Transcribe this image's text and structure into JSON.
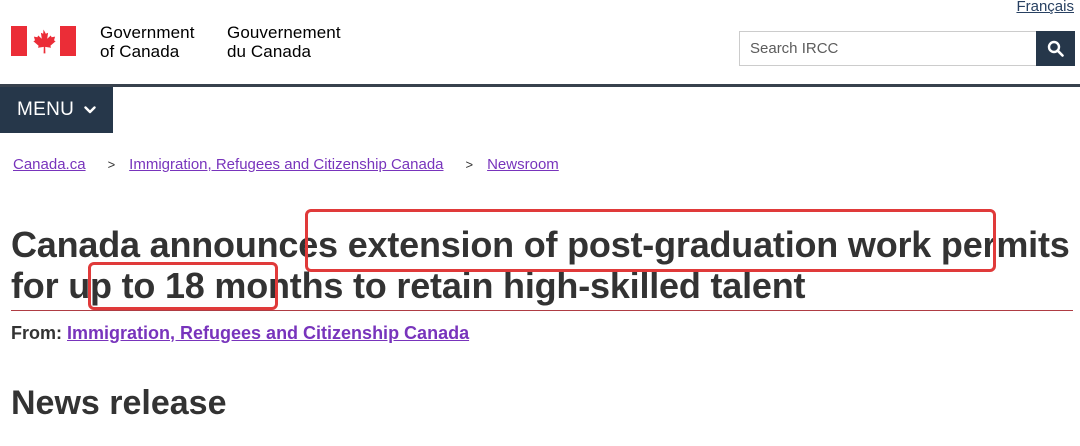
{
  "header": {
    "language_link": "Français",
    "wordmark_en_line1": "Government",
    "wordmark_en_line2": "of Canada",
    "wordmark_fr_line1": "Gouvernement",
    "wordmark_fr_line2": "du Canada",
    "search_placeholder": "Search IRCC",
    "search_icon": "search-icon",
    "flag_icon": "canada-flag-icon",
    "menu_label": "MENU"
  },
  "breadcrumb": {
    "items": [
      "Canada.ca",
      "Immigration, Refugees and Citizenship Canada",
      "Newsroom"
    ],
    "separator": ">"
  },
  "title": {
    "part1": "Canada announces ",
    "part2": "extension of post-graduation work permits",
    "part3": " for up to ",
    "part4": "18 months",
    "part5": " to retain high-skilled talent"
  },
  "from": {
    "label": "From:",
    "link": "Immigration, Refugees and Citizenship Canada"
  },
  "section_heading": "News release",
  "colors": {
    "header_navy": "#26374a",
    "link_visited": "#7834bc",
    "highlight_red": "#e03a3a",
    "flag_red": "#eb2d37"
  }
}
